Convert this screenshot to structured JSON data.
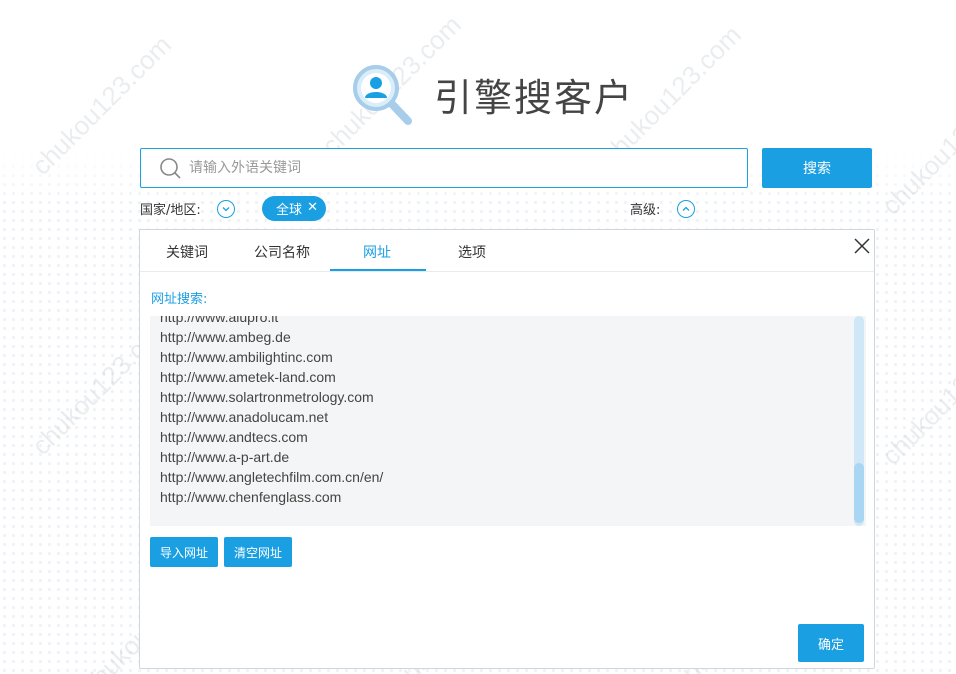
{
  "colors": {
    "accent": "#1a9fe3",
    "text": "#333333",
    "muted": "#999999",
    "panel_bg": "#f4f5f6"
  },
  "header": {
    "title": "引擎搜客户",
    "logo_icon": "user-search-icon"
  },
  "search": {
    "placeholder": "请输入外语关键词",
    "value": "",
    "button_label": "搜索",
    "icon": "search-icon"
  },
  "filters": {
    "region_label": "国家/地区:",
    "region_toggle_icon": "chevron-down-icon",
    "region_tag": "全球",
    "region_tag_remove_icon": "close-icon",
    "advanced_label": "高级:",
    "advanced_toggle_icon": "chevron-up-icon"
  },
  "panel": {
    "tabs": [
      {
        "label": "关键词",
        "active": false
      },
      {
        "label": "公司名称",
        "active": false
      },
      {
        "label": "网址",
        "active": true
      },
      {
        "label": "选项",
        "active": false
      }
    ],
    "close_icon": "close-icon",
    "url_label": "网址搜索:",
    "urls": [
      "http://www.alupro.it",
      "http://www.ambeg.de",
      "http://www.ambilightinc.com",
      "http://www.ametek-land.com",
      "http://www.solartronmetrology.com",
      "http://www.anadolucam.net",
      "http://www.andtecs.com",
      "http://www.a-p-art.de",
      "http://www.angletechfilm.com.cn/en/",
      "http://www.chenfenglass.com"
    ],
    "import_button": "导入网址",
    "clear_button": "清空网址",
    "confirm_button": "确定"
  }
}
